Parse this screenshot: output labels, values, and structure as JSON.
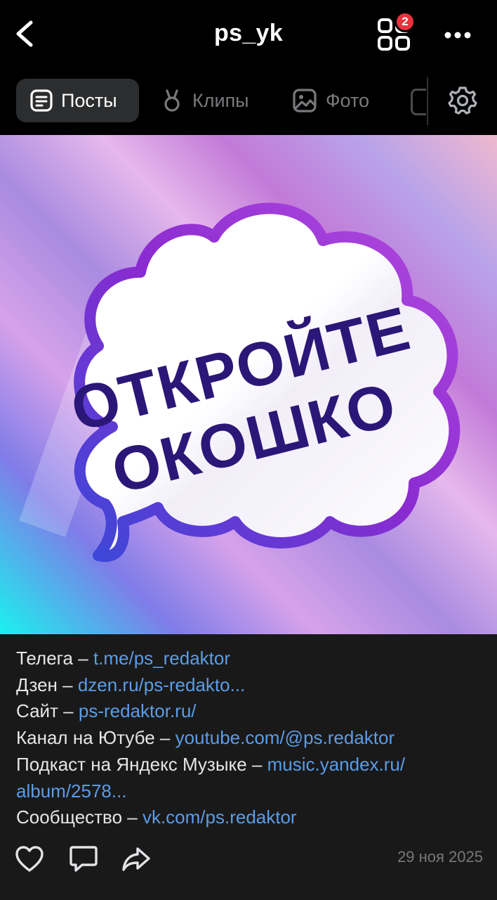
{
  "header": {
    "title": "ps_yk",
    "badge": "2"
  },
  "tabs": [
    {
      "label": "Посты",
      "icon": "posts-icon",
      "active": true
    },
    {
      "label": "Клипы",
      "icon": "clips-icon",
      "active": false
    },
    {
      "label": "Фото",
      "icon": "photo-icon",
      "active": false
    }
  ],
  "post": {
    "image_text_line1": "ОТКРОЙТЕ",
    "image_text_line2": "ОКОШКО",
    "lines": [
      {
        "label": "Телега – ",
        "link": "t.me/ps_redaktor"
      },
      {
        "label": "Дзен – ",
        "link": "dzen.ru/ps-redakto..."
      },
      {
        "label": "Сайт – ",
        "link": "ps-redaktor.ru/"
      },
      {
        "label": "Канал на Ютубе – ",
        "link": "youtube.com/@ps.redaktor"
      },
      {
        "label": "Подкаст на Яндекс Музыке – ",
        "link": "music.yandex.ru/"
      },
      {
        "label": "",
        "link": "album/2578..."
      },
      {
        "label": "Сообщество – ",
        "link": "vk.com/ps.redaktor"
      }
    ],
    "date": "29 ноя 2025"
  },
  "colors": {
    "link": "#5c9ce6",
    "background": "#000000",
    "caption_bg": "#191919",
    "badge": "#e8333e"
  }
}
